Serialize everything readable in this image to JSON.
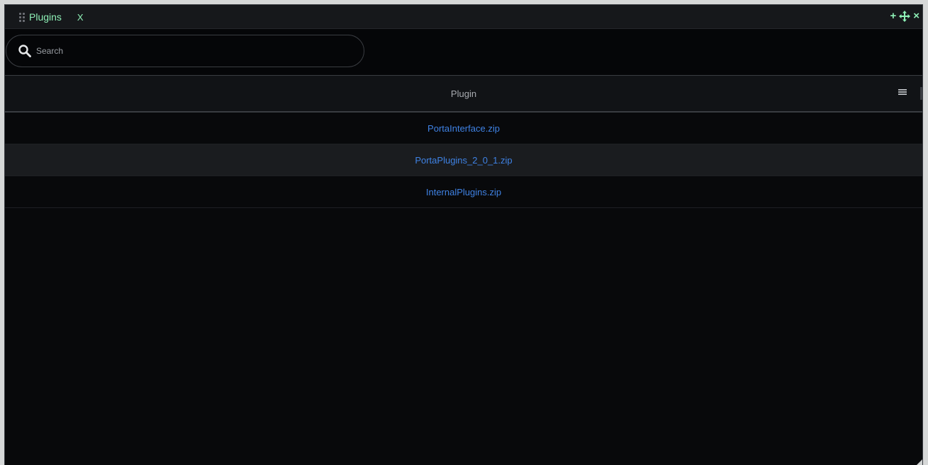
{
  "window": {
    "tab_label": "Plugins",
    "tab_close_label": "X",
    "controls": {
      "add": "+",
      "close": "×"
    }
  },
  "search": {
    "placeholder": "Search",
    "value": ""
  },
  "table": {
    "header": "Plugin",
    "rows": [
      "PortaInterface.zip",
      "PortaPlugins_2_0_1.zip",
      "InternalPlugins.zip"
    ],
    "selected_row": 1
  },
  "colors": {
    "accent": "#8ef0b6",
    "link": "#3f82e4",
    "background": "#08090b"
  },
  "icons": [
    "drag-handle-icon",
    "add-icon",
    "move-icon",
    "close-icon",
    "search-icon",
    "column-menu-icon"
  ]
}
